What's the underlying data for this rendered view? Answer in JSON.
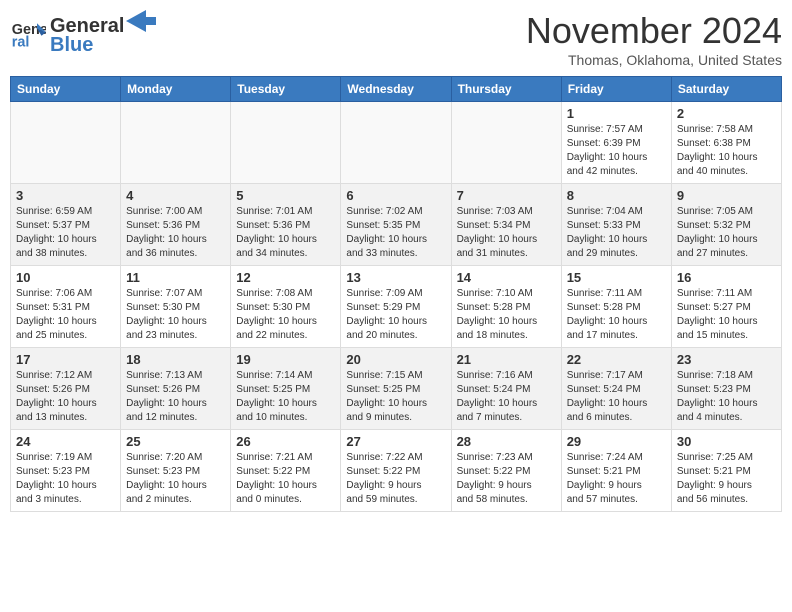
{
  "header": {
    "logo_line1": "General",
    "logo_line2": "Blue",
    "month": "November 2024",
    "location": "Thomas, Oklahoma, United States"
  },
  "weekdays": [
    "Sunday",
    "Monday",
    "Tuesday",
    "Wednesday",
    "Thursday",
    "Friday",
    "Saturday"
  ],
  "weeks": [
    [
      {
        "day": "",
        "info": ""
      },
      {
        "day": "",
        "info": ""
      },
      {
        "day": "",
        "info": ""
      },
      {
        "day": "",
        "info": ""
      },
      {
        "day": "",
        "info": ""
      },
      {
        "day": "1",
        "info": "Sunrise: 7:57 AM\nSunset: 6:39 PM\nDaylight: 10 hours\nand 42 minutes."
      },
      {
        "day": "2",
        "info": "Sunrise: 7:58 AM\nSunset: 6:38 PM\nDaylight: 10 hours\nand 40 minutes."
      }
    ],
    [
      {
        "day": "3",
        "info": "Sunrise: 6:59 AM\nSunset: 5:37 PM\nDaylight: 10 hours\nand 38 minutes."
      },
      {
        "day": "4",
        "info": "Sunrise: 7:00 AM\nSunset: 5:36 PM\nDaylight: 10 hours\nand 36 minutes."
      },
      {
        "day": "5",
        "info": "Sunrise: 7:01 AM\nSunset: 5:36 PM\nDaylight: 10 hours\nand 34 minutes."
      },
      {
        "day": "6",
        "info": "Sunrise: 7:02 AM\nSunset: 5:35 PM\nDaylight: 10 hours\nand 33 minutes."
      },
      {
        "day": "7",
        "info": "Sunrise: 7:03 AM\nSunset: 5:34 PM\nDaylight: 10 hours\nand 31 minutes."
      },
      {
        "day": "8",
        "info": "Sunrise: 7:04 AM\nSunset: 5:33 PM\nDaylight: 10 hours\nand 29 minutes."
      },
      {
        "day": "9",
        "info": "Sunrise: 7:05 AM\nSunset: 5:32 PM\nDaylight: 10 hours\nand 27 minutes."
      }
    ],
    [
      {
        "day": "10",
        "info": "Sunrise: 7:06 AM\nSunset: 5:31 PM\nDaylight: 10 hours\nand 25 minutes."
      },
      {
        "day": "11",
        "info": "Sunrise: 7:07 AM\nSunset: 5:30 PM\nDaylight: 10 hours\nand 23 minutes."
      },
      {
        "day": "12",
        "info": "Sunrise: 7:08 AM\nSunset: 5:30 PM\nDaylight: 10 hours\nand 22 minutes."
      },
      {
        "day": "13",
        "info": "Sunrise: 7:09 AM\nSunset: 5:29 PM\nDaylight: 10 hours\nand 20 minutes."
      },
      {
        "day": "14",
        "info": "Sunrise: 7:10 AM\nSunset: 5:28 PM\nDaylight: 10 hours\nand 18 minutes."
      },
      {
        "day": "15",
        "info": "Sunrise: 7:11 AM\nSunset: 5:28 PM\nDaylight: 10 hours\nand 17 minutes."
      },
      {
        "day": "16",
        "info": "Sunrise: 7:11 AM\nSunset: 5:27 PM\nDaylight: 10 hours\nand 15 minutes."
      }
    ],
    [
      {
        "day": "17",
        "info": "Sunrise: 7:12 AM\nSunset: 5:26 PM\nDaylight: 10 hours\nand 13 minutes."
      },
      {
        "day": "18",
        "info": "Sunrise: 7:13 AM\nSunset: 5:26 PM\nDaylight: 10 hours\nand 12 minutes."
      },
      {
        "day": "19",
        "info": "Sunrise: 7:14 AM\nSunset: 5:25 PM\nDaylight: 10 hours\nand 10 minutes."
      },
      {
        "day": "20",
        "info": "Sunrise: 7:15 AM\nSunset: 5:25 PM\nDaylight: 10 hours\nand 9 minutes."
      },
      {
        "day": "21",
        "info": "Sunrise: 7:16 AM\nSunset: 5:24 PM\nDaylight: 10 hours\nand 7 minutes."
      },
      {
        "day": "22",
        "info": "Sunrise: 7:17 AM\nSunset: 5:24 PM\nDaylight: 10 hours\nand 6 minutes."
      },
      {
        "day": "23",
        "info": "Sunrise: 7:18 AM\nSunset: 5:23 PM\nDaylight: 10 hours\nand 4 minutes."
      }
    ],
    [
      {
        "day": "24",
        "info": "Sunrise: 7:19 AM\nSunset: 5:23 PM\nDaylight: 10 hours\nand 3 minutes."
      },
      {
        "day": "25",
        "info": "Sunrise: 7:20 AM\nSunset: 5:23 PM\nDaylight: 10 hours\nand 2 minutes."
      },
      {
        "day": "26",
        "info": "Sunrise: 7:21 AM\nSunset: 5:22 PM\nDaylight: 10 hours\nand 0 minutes."
      },
      {
        "day": "27",
        "info": "Sunrise: 7:22 AM\nSunset: 5:22 PM\nDaylight: 9 hours\nand 59 minutes."
      },
      {
        "day": "28",
        "info": "Sunrise: 7:23 AM\nSunset: 5:22 PM\nDaylight: 9 hours\nand 58 minutes."
      },
      {
        "day": "29",
        "info": "Sunrise: 7:24 AM\nSunset: 5:21 PM\nDaylight: 9 hours\nand 57 minutes."
      },
      {
        "day": "30",
        "info": "Sunrise: 7:25 AM\nSunset: 5:21 PM\nDaylight: 9 hours\nand 56 minutes."
      }
    ]
  ]
}
